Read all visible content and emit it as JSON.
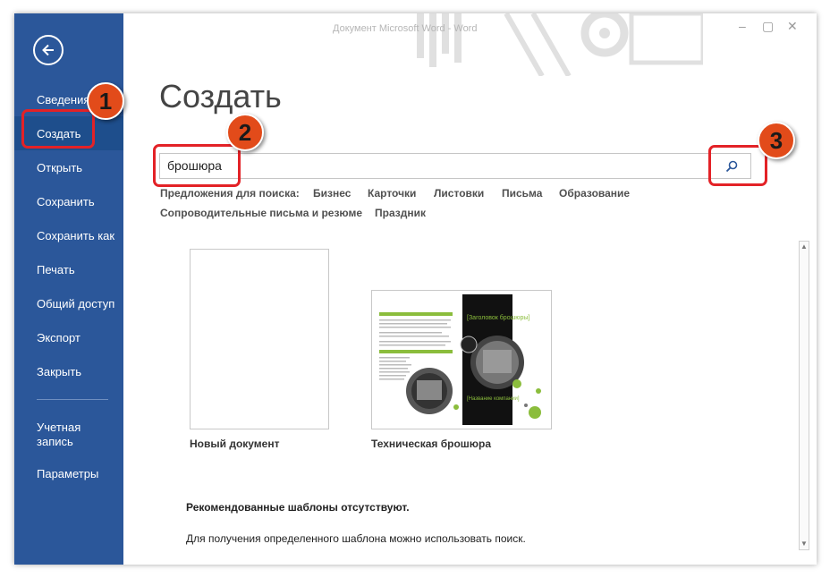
{
  "window": {
    "title": "Документ Microsoft Word - Word",
    "minimize": "–",
    "restore": "▢",
    "close": "✕"
  },
  "sidebar": {
    "items": [
      {
        "label": "Сведения"
      },
      {
        "label": "Создать"
      },
      {
        "label": "Открыть"
      },
      {
        "label": "Сохранить"
      },
      {
        "label": "Сохранить как"
      },
      {
        "label": "Печать"
      },
      {
        "label": "Общий доступ"
      },
      {
        "label": "Экспорт"
      },
      {
        "label": "Закрыть"
      },
      {
        "label": "Учетная запись"
      },
      {
        "label": "Параметры"
      }
    ],
    "active": "Создать",
    "accent": "#2b579a"
  },
  "main": {
    "title": "Создать",
    "search": {
      "value": "брошюра",
      "button_icon": "search-icon"
    },
    "suggestions_label": "Предложения для поиска:",
    "suggestions": [
      "Бизнес",
      "Карточки",
      "Листовки",
      "Письма",
      "Образование",
      "Сопроводительные письма и резюме",
      "Праздник"
    ],
    "templates": [
      {
        "label": "Новый документ"
      },
      {
        "label": "Техническая брошюра",
        "preview": {
          "heading": "[Заголовок брошюры]",
          "company": "[Название компании]"
        }
      }
    ],
    "no_templates_title": "Рекомендованные шаблоны отсутствуют.",
    "no_templates_hint": "Для получения определенного шаблона можно использовать поиск."
  },
  "callouts": [
    "1",
    "2",
    "3"
  ],
  "callout_color": "#e32227"
}
